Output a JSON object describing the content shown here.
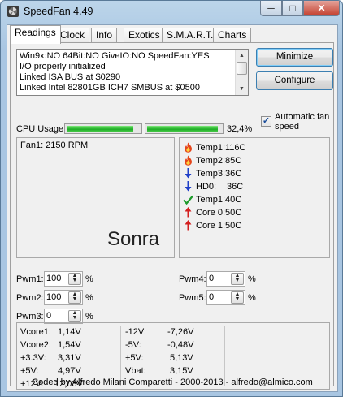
{
  "window": {
    "title": "SpeedFan 4.49",
    "minimize": "─",
    "maximize": "□",
    "close": "✕"
  },
  "tabs": [
    {
      "label": "Readings",
      "active": true
    },
    {
      "label": "Clock"
    },
    {
      "label": "Info"
    },
    {
      "label": "Exotics"
    },
    {
      "label": "S.M.A.R.T."
    },
    {
      "label": "Charts"
    }
  ],
  "log": [
    "Win9x:NO  64Bit:NO  GiveIO:NO  SpeedFan:YES",
    "I/O properly initialized",
    "Linked ISA BUS at $0290",
    "Linked Intel 82801GB ICH7 SMBUS at $0500"
  ],
  "buttons": {
    "minimize": "Minimize",
    "configure": "Configure"
  },
  "auto_fan": {
    "label": "Automatic fan speed",
    "checked": true
  },
  "cpu": {
    "label": "CPU Usage",
    "bar1": 0.92,
    "bar2": 0.96,
    "percent": "32,4%"
  },
  "fans": {
    "fan1": "Fan1: 2150 RPM",
    "overlay": "Sonra"
  },
  "temps": [
    {
      "icon": "flame-icon",
      "name": "Temp1:",
      "value": "116C",
      "color": "#e5451b"
    },
    {
      "icon": "flame-icon",
      "name": "Temp2:",
      "value": "85C",
      "color": "#e5451b"
    },
    {
      "icon": "arrow-down-icon",
      "name": "Temp3:",
      "value": "36C",
      "color": "#1f3fc8"
    },
    {
      "icon": "arrow-down-icon",
      "name": "HD0:",
      "value": "36C",
      "color": "#1f3fc8"
    },
    {
      "icon": "checkmark-icon",
      "name": "Temp1:",
      "value": "40C",
      "color": "#1d9a2a"
    },
    {
      "icon": "arrow-up-icon",
      "name": "Core 0:",
      "value": "50C",
      "color": "#d42020"
    },
    {
      "icon": "arrow-up-icon",
      "name": "Core 1:",
      "value": "50C",
      "color": "#d42020"
    }
  ],
  "pwm": {
    "pwm1": {
      "label": "Pwm1:",
      "value": "100",
      "unit": "%"
    },
    "pwm2": {
      "label": "Pwm2:",
      "value": "100",
      "unit": "%"
    },
    "pwm3": {
      "label": "Pwm3:",
      "value": "0",
      "unit": "%"
    },
    "pwm4": {
      "label": "Pwm4:",
      "value": "0",
      "unit": "%"
    },
    "pwm5": {
      "label": "Pwm5:",
      "value": "0",
      "unit": "%"
    }
  },
  "voltages": {
    "left": [
      {
        "label": "Vcore1:",
        "value": "1,14V"
      },
      {
        "label": "Vcore2:",
        "value": "1,54V"
      },
      {
        "label": "+3.3V:",
        "value": "3,31V"
      },
      {
        "label": "+5V:",
        "value": "4,97V"
      },
      {
        "label": "+12V:",
        "value": "12,03V"
      }
    ],
    "right": [
      {
        "label": "-12V:",
        "value": "-7,26V"
      },
      {
        "label": "-5V:",
        "value": "-0,48V"
      },
      {
        "label": "+5V:",
        "value": "5,13V"
      },
      {
        "label": "Vbat:",
        "value": "3,15V"
      }
    ]
  },
  "status": "Coded by Alfredo Milani Comparetti - 2000-2013 - alfredo@almico.com"
}
